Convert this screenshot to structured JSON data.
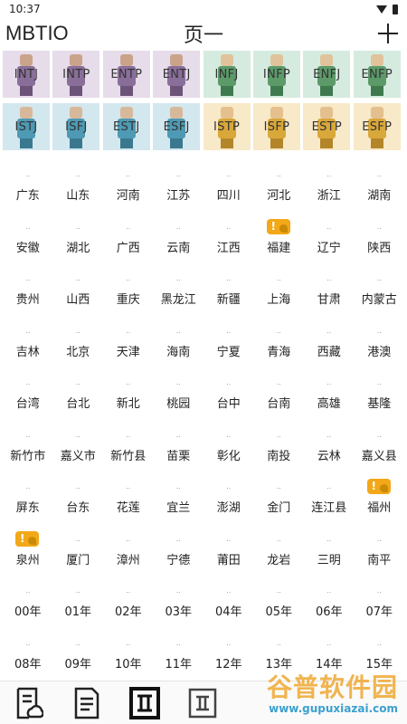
{
  "status": {
    "time": "10:37"
  },
  "header": {
    "app_title": "MBTIO",
    "page_title": "页一",
    "add_icon": "plus-icon"
  },
  "colors": {
    "analyst_bg": "#e6dcea",
    "diplomat_bg": "#d6ebe0",
    "sentinel_bg": "#d3e7ee",
    "explorer_bg": "#f8e9c8",
    "warning": "#f2a818"
  },
  "mbti_types": [
    {
      "code": "INTJ",
      "group": "analyst"
    },
    {
      "code": "INTP",
      "group": "analyst"
    },
    {
      "code": "ENTP",
      "group": "analyst"
    },
    {
      "code": "ENTJ",
      "group": "analyst"
    },
    {
      "code": "INFJ",
      "group": "diplomat"
    },
    {
      "code": "INFP",
      "group": "diplomat"
    },
    {
      "code": "ENFJ",
      "group": "diplomat"
    },
    {
      "code": "ENFP",
      "group": "diplomat"
    },
    {
      "code": "ISTJ",
      "group": "sentinel"
    },
    {
      "code": "ISFJ",
      "group": "sentinel"
    },
    {
      "code": "ESTJ",
      "group": "sentinel"
    },
    {
      "code": "ESFJ",
      "group": "sentinel"
    },
    {
      "code": "ISTP",
      "group": "explorer"
    },
    {
      "code": "ISFP",
      "group": "explorer"
    },
    {
      "code": "ESTP",
      "group": "explorer"
    },
    {
      "code": "ESFP",
      "group": "explorer"
    }
  ],
  "cells": [
    {
      "label": "广东"
    },
    {
      "label": "山东"
    },
    {
      "label": "河南"
    },
    {
      "label": "江苏"
    },
    {
      "label": "四川"
    },
    {
      "label": "河北"
    },
    {
      "label": "浙江"
    },
    {
      "label": "湖南"
    },
    {
      "label": "安徽"
    },
    {
      "label": "湖北"
    },
    {
      "label": "广西"
    },
    {
      "label": "云南"
    },
    {
      "label": "江西"
    },
    {
      "label": "福建",
      "warning": true
    },
    {
      "label": "辽宁"
    },
    {
      "label": "陕西"
    },
    {
      "label": "贵州"
    },
    {
      "label": "山西"
    },
    {
      "label": "重庆"
    },
    {
      "label": "黑龙江"
    },
    {
      "label": "新疆"
    },
    {
      "label": "上海"
    },
    {
      "label": "甘肃"
    },
    {
      "label": "内蒙古"
    },
    {
      "label": "吉林"
    },
    {
      "label": "北京"
    },
    {
      "label": "天津"
    },
    {
      "label": "海南"
    },
    {
      "label": "宁夏"
    },
    {
      "label": "青海"
    },
    {
      "label": "西藏"
    },
    {
      "label": "港澳"
    },
    {
      "label": "台湾"
    },
    {
      "label": "台北"
    },
    {
      "label": "新北"
    },
    {
      "label": "桃园"
    },
    {
      "label": "台中"
    },
    {
      "label": "台南"
    },
    {
      "label": "高雄"
    },
    {
      "label": "基隆"
    },
    {
      "label": "新竹市"
    },
    {
      "label": "嘉义市"
    },
    {
      "label": "新竹县"
    },
    {
      "label": "苗栗"
    },
    {
      "label": "彰化"
    },
    {
      "label": "南投"
    },
    {
      "label": "云林"
    },
    {
      "label": "嘉义县"
    },
    {
      "label": "屏东"
    },
    {
      "label": "台东"
    },
    {
      "label": "花莲"
    },
    {
      "label": "宜兰"
    },
    {
      "label": "澎湖"
    },
    {
      "label": "金门"
    },
    {
      "label": "连江县"
    },
    {
      "label": "福州",
      "warning": true
    },
    {
      "label": "泉州",
      "warning": true
    },
    {
      "label": "厦门"
    },
    {
      "label": "漳州"
    },
    {
      "label": "宁德"
    },
    {
      "label": "莆田"
    },
    {
      "label": "龙岩"
    },
    {
      "label": "三明"
    },
    {
      "label": "南平"
    },
    {
      "label": "00年"
    },
    {
      "label": "01年"
    },
    {
      "label": "02年"
    },
    {
      "label": "03年"
    },
    {
      "label": "04年"
    },
    {
      "label": "05年"
    },
    {
      "label": "06年"
    },
    {
      "label": "07年"
    },
    {
      "label": "08年"
    },
    {
      "label": "09年"
    },
    {
      "label": "10年"
    },
    {
      "label": "11年"
    },
    {
      "label": "12年"
    },
    {
      "label": "13年"
    },
    {
      "label": "14年"
    },
    {
      "label": "15年"
    }
  ],
  "cell_dots": "..",
  "warning_glyph": "!",
  "bottom_nav": [
    {
      "icon": "note-cloud-icon"
    },
    {
      "icon": "notes-icon"
    },
    {
      "icon": "page-one-icon",
      "active": true
    },
    {
      "icon": "page-two-icon"
    }
  ],
  "watermark": {
    "title": "谷普软件园",
    "url": "www.gupuxiazai.com"
  }
}
